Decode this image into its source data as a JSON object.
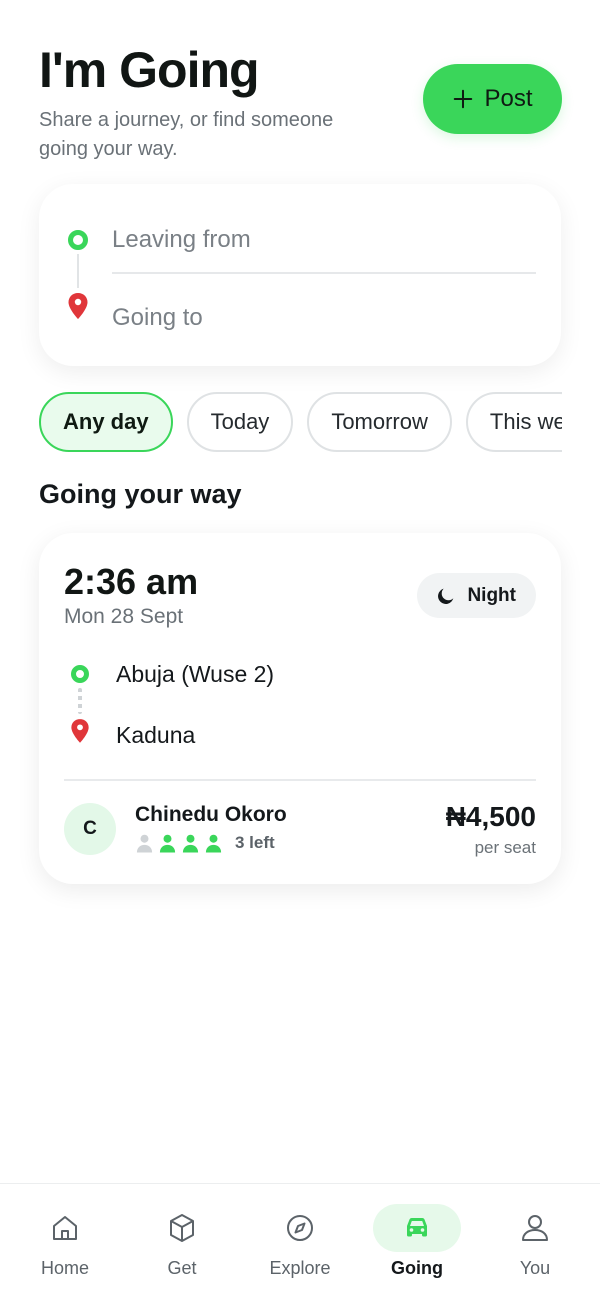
{
  "header": {
    "title": "I'm Going",
    "subtitle": "Share a journey, or find someone going your way.",
    "post_label": "Post"
  },
  "search": {
    "from_placeholder": "Leaving from",
    "to_placeholder": "Going to"
  },
  "filters": {
    "chips": [
      "Any day",
      "Today",
      "Tomorrow",
      "This we"
    ],
    "selected": "Any day"
  },
  "section_title": "Going your way",
  "ride": {
    "time": "2:36 am",
    "date": "Mon 28 Sept",
    "badge": "Night",
    "from": "Abuja (Wuse 2)",
    "to": "Kaduna",
    "driver_initial": "C",
    "driver_name": "Chinedu Okoro",
    "seats_total": 4,
    "seats_taken": 1,
    "seats_left_label": "3 left",
    "price": "₦4,500",
    "price_unit": "per seat"
  },
  "tabs": [
    {
      "label": "Home",
      "icon": "home-icon"
    },
    {
      "label": "Get",
      "icon": "box-icon"
    },
    {
      "label": "Explore",
      "icon": "compass-icon"
    },
    {
      "label": "Going",
      "icon": "car-icon",
      "active": true
    },
    {
      "label": "You",
      "icon": "user-icon"
    }
  ],
  "colors": {
    "accent": "#3ad65a",
    "accent_light": "#e9fbed",
    "destination_red": "#e0363a"
  }
}
